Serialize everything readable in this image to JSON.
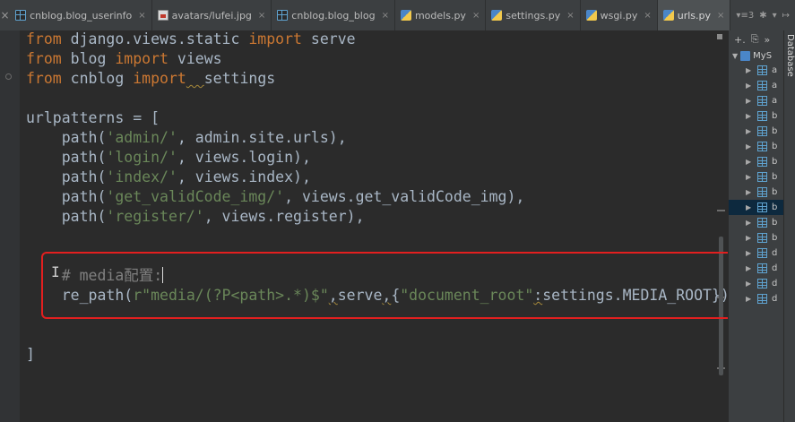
{
  "tabs": [
    {
      "label": "cnblog.blog_userinfo",
      "icon": "table-icon",
      "active": false
    },
    {
      "label": "avatars/lufei.jpg",
      "icon": "image-file-icon",
      "active": false
    },
    {
      "label": "cnblog.blog_blog",
      "icon": "table-icon",
      "active": false
    },
    {
      "label": "models.py",
      "icon": "python-file-icon",
      "active": false
    },
    {
      "label": "settings.py",
      "icon": "python-file-icon",
      "active": false
    },
    {
      "label": "wsgi.py",
      "icon": "python-file-icon",
      "active": false
    },
    {
      "label": "urls.py",
      "icon": "python-file-icon",
      "active": true
    }
  ],
  "tab_close_glyph": "×",
  "tab_overflow": "▾≡3",
  "tool_icons": [
    "✱",
    "▾",
    "↦"
  ],
  "database_panel": {
    "vertical_title": "Database",
    "toolbar": [
      "+.",
      "⎘",
      "»"
    ],
    "root_label": "MyS",
    "tables": [
      "a",
      "a",
      "a",
      "b",
      "b",
      "b",
      "b",
      "b",
      "b",
      "b",
      "b",
      "b",
      "d",
      "d",
      "d",
      "d"
    ],
    "selected_index": 9
  },
  "code_lines": [
    [
      {
        "t": "from",
        "c": "kw"
      },
      {
        "t": " django.views.static ",
        "c": "fn"
      },
      {
        "t": "import",
        "c": "kw"
      },
      {
        "t": " serve",
        "c": "fn"
      }
    ],
    [
      {
        "t": "from",
        "c": "kw"
      },
      {
        "t": " blog ",
        "c": "fn"
      },
      {
        "t": "import",
        "c": "kw"
      },
      {
        "t": " views",
        "c": "fn"
      }
    ],
    [
      {
        "t": "from",
        "c": "kw"
      },
      {
        "t": " cnblog ",
        "c": "fn"
      },
      {
        "t": "import",
        "c": "kw"
      },
      {
        "t": "  ",
        "c": "squig"
      },
      {
        "t": "settings",
        "c": "fn"
      }
    ],
    [],
    [
      {
        "t": "urlpatterns = [",
        "c": "fn"
      }
    ],
    [
      {
        "t": "    path(",
        "c": "fn"
      },
      {
        "t": "'admin/'",
        "c": "str"
      },
      {
        "t": ", admin.site.urls),",
        "c": "fn"
      }
    ],
    [
      {
        "t": "    path(",
        "c": "fn"
      },
      {
        "t": "'login/'",
        "c": "str"
      },
      {
        "t": ", views.login),",
        "c": "fn"
      }
    ],
    [
      {
        "t": "    path(",
        "c": "fn"
      },
      {
        "t": "'index/'",
        "c": "str"
      },
      {
        "t": ", views.index),",
        "c": "fn"
      }
    ],
    [
      {
        "t": "    path(",
        "c": "fn"
      },
      {
        "t": "'get_validCode_img/'",
        "c": "str"
      },
      {
        "t": ", views.get_validCode_img),",
        "c": "fn"
      }
    ],
    [
      {
        "t": "    path(",
        "c": "fn"
      },
      {
        "t": "'register/'",
        "c": "str"
      },
      {
        "t": ", views.register),",
        "c": "fn"
      }
    ],
    [],
    [],
    [
      {
        "t": "    ",
        "c": "fn"
      },
      {
        "t": "# media配置:",
        "c": "cmt"
      },
      {
        "t": "",
        "c": "caret"
      }
    ],
    [
      {
        "t": "    re_path(",
        "c": "fn"
      },
      {
        "t": "r\"media/(?P<path>.*)$\"",
        "c": "str"
      },
      {
        "t": ",",
        "c": "squig"
      },
      {
        "t": "serve",
        "c": "fn"
      },
      {
        "t": ",",
        "c": "squig"
      },
      {
        "t": "{",
        "c": "fn"
      },
      {
        "t": "\"document_root\"",
        "c": "str"
      },
      {
        "t": ":",
        "c": "squig"
      },
      {
        "t": "settings.MEDIA_ROOT}),",
        "c": "fn"
      }
    ],
    [],
    [],
    [
      {
        "t": "]",
        "c": "fn"
      }
    ]
  ],
  "colors": {
    "keyword": "#cc7832",
    "string": "#6a8759",
    "comment": "#808080",
    "text": "#a9b7c6",
    "highlight_box": "#e21f1f"
  }
}
